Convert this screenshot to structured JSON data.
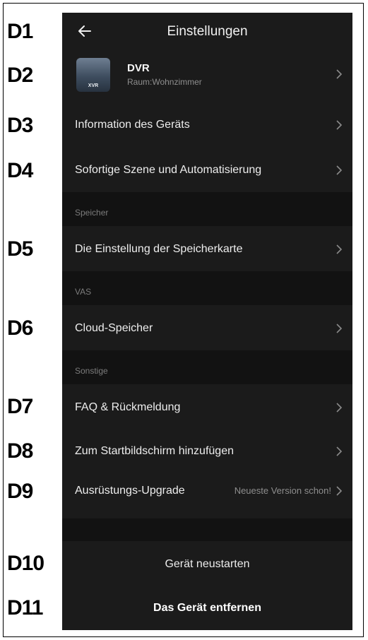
{
  "labels": [
    "D1",
    "D2",
    "D3",
    "D4",
    "D5",
    "D6",
    "D7",
    "D8",
    "D9",
    "D10",
    "D11"
  ],
  "header": {
    "title": "Einstellungen",
    "back_icon": "arrow-left-icon"
  },
  "device": {
    "thumb_text": "XVR",
    "name": "DVR",
    "room": "Raum:Wohnzimmer"
  },
  "menu": {
    "device_info": "Information des Geräts",
    "scene": "Sofortige Szene und Automatisierung"
  },
  "sections": {
    "storage": {
      "title": "Speicher",
      "item": "Die Einstellung der Speicherkarte"
    },
    "vas": {
      "title": "VAS",
      "item": "Cloud-Speicher"
    },
    "other": {
      "title": "Sonstige",
      "faq": "FAQ & Rückmeldung",
      "homescreen": "Zum Startbildschirm hinzufügen",
      "upgrade": "Ausrüstungs-Upgrade",
      "upgrade_status": "Neueste Version schon!"
    }
  },
  "actions": {
    "restart": "Gerät neustarten",
    "remove": "Das Gerät entfernen"
  },
  "colors": {
    "background": "#1b1b1b",
    "section_gap": "#121212",
    "text": "#ececec",
    "muted": "#8e8e8e"
  }
}
